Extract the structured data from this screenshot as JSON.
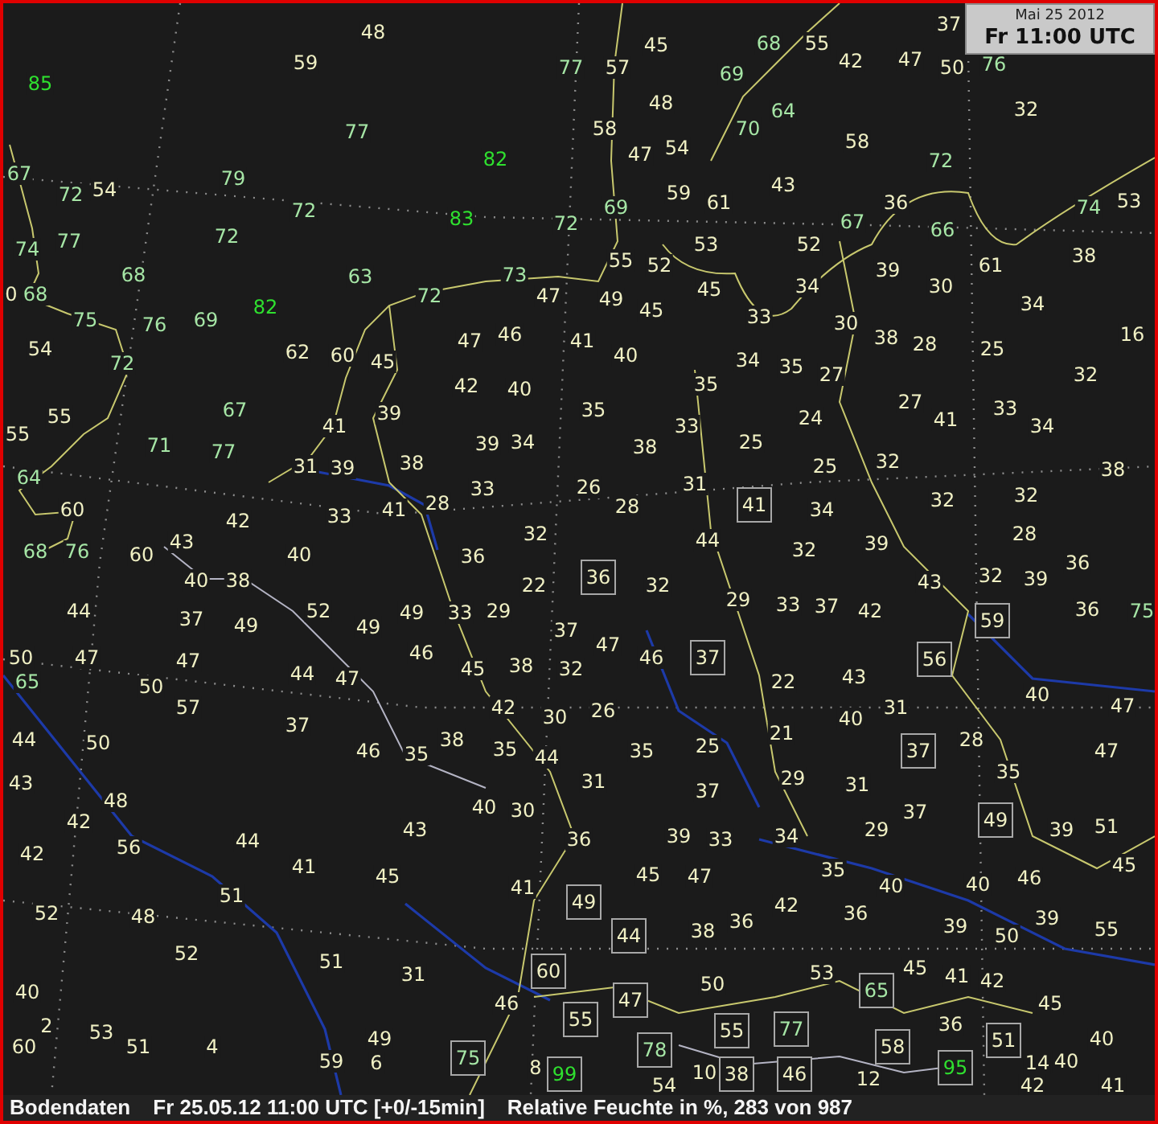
{
  "header": {
    "date": "Mai 25 2012",
    "time": "Fr 11:00 UTC"
  },
  "stations": [
    {
      "value": "48",
      "kind": "land",
      "boxed": false
    },
    {
      "value": "37",
      "kind": "land",
      "boxed": false
    },
    {
      "value": "45",
      "kind": "land",
      "boxed": false
    },
    {
      "value": "68",
      "kind": "sea",
      "boxed": false
    },
    {
      "value": "55",
      "kind": "land",
      "boxed": false
    },
    {
      "value": "59",
      "kind": "land",
      "boxed": false
    },
    {
      "value": "77",
      "kind": "sea",
      "boxed": false
    },
    {
      "value": "57",
      "kind": "land",
      "boxed": false
    },
    {
      "value": "69",
      "kind": "sea",
      "boxed": false
    },
    {
      "value": "42",
      "kind": "land",
      "boxed": false
    },
    {
      "value": "47",
      "kind": "land",
      "boxed": false
    },
    {
      "value": "50",
      "kind": "land",
      "boxed": false
    },
    {
      "value": "76",
      "kind": "sea",
      "boxed": false
    },
    {
      "value": "85",
      "kind": "high",
      "boxed": false
    },
    {
      "value": "48",
      "kind": "land",
      "boxed": false
    },
    {
      "value": "64",
      "kind": "sea",
      "boxed": false
    },
    {
      "value": "32",
      "kind": "land",
      "boxed": false
    },
    {
      "value": "77",
      "kind": "sea",
      "boxed": false
    },
    {
      "value": "58",
      "kind": "land",
      "boxed": false
    },
    {
      "value": "70",
      "kind": "sea",
      "boxed": false
    },
    {
      "value": "54",
      "kind": "land",
      "boxed": false
    },
    {
      "value": "58",
      "kind": "land",
      "boxed": false
    },
    {
      "value": "82",
      "kind": "high",
      "boxed": false
    },
    {
      "value": "47",
      "kind": "land",
      "boxed": false
    },
    {
      "value": "72",
      "kind": "sea",
      "boxed": false
    },
    {
      "value": "67",
      "kind": "sea",
      "boxed": false
    },
    {
      "value": "54",
      "kind": "land",
      "boxed": false
    },
    {
      "value": "79",
      "kind": "sea",
      "boxed": false
    },
    {
      "value": "43",
      "kind": "land",
      "boxed": false
    },
    {
      "value": "72",
      "kind": "sea",
      "boxed": false
    },
    {
      "value": "72",
      "kind": "sea",
      "boxed": false
    },
    {
      "value": "69",
      "kind": "sea",
      "boxed": false
    },
    {
      "value": "59",
      "kind": "land",
      "boxed": false
    },
    {
      "value": "61",
      "kind": "land",
      "boxed": false
    },
    {
      "value": "36",
      "kind": "land",
      "boxed": false
    },
    {
      "value": "74",
      "kind": "sea",
      "boxed": false
    },
    {
      "value": "53",
      "kind": "land",
      "boxed": false
    },
    {
      "value": "83",
      "kind": "high",
      "boxed": false
    },
    {
      "value": "72",
      "kind": "sea",
      "boxed": false
    },
    {
      "value": "67",
      "kind": "sea",
      "boxed": false
    },
    {
      "value": "66",
      "kind": "sea",
      "boxed": false
    },
    {
      "value": "74",
      "kind": "sea",
      "boxed": false
    },
    {
      "value": "77",
      "kind": "sea",
      "boxed": false
    },
    {
      "value": "72",
      "kind": "sea",
      "boxed": false
    },
    {
      "value": "53",
      "kind": "land",
      "boxed": false
    },
    {
      "value": "52",
      "kind": "land",
      "boxed": false
    },
    {
      "value": "55",
      "kind": "land",
      "boxed": false
    },
    {
      "value": "52",
      "kind": "land",
      "boxed": false
    },
    {
      "value": "61",
      "kind": "land",
      "boxed": false
    },
    {
      "value": "38",
      "kind": "land",
      "boxed": false
    },
    {
      "value": "68",
      "kind": "sea",
      "boxed": false
    },
    {
      "value": "63",
      "kind": "sea",
      "boxed": false
    },
    {
      "value": "73",
      "kind": "sea",
      "boxed": false
    },
    {
      "value": "34",
      "kind": "land",
      "boxed": false
    },
    {
      "value": "39",
      "kind": "land",
      "boxed": false
    },
    {
      "value": "30",
      "kind": "land",
      "boxed": false
    },
    {
      "value": "0",
      "kind": "land",
      "boxed": false
    },
    {
      "value": "68",
      "kind": "sea",
      "boxed": false
    },
    {
      "value": "82",
      "kind": "high",
      "boxed": false
    },
    {
      "value": "72",
      "kind": "sea",
      "boxed": false
    },
    {
      "value": "47",
      "kind": "land",
      "boxed": false
    },
    {
      "value": "49",
      "kind": "land",
      "boxed": false
    },
    {
      "value": "45",
      "kind": "land",
      "boxed": false
    },
    {
      "value": "34",
      "kind": "land",
      "boxed": false
    },
    {
      "value": "75",
      "kind": "sea",
      "boxed": false
    },
    {
      "value": "76",
      "kind": "sea",
      "boxed": false
    },
    {
      "value": "69",
      "kind": "sea",
      "boxed": false
    },
    {
      "value": "45",
      "kind": "land",
      "boxed": false
    },
    {
      "value": "33",
      "kind": "land",
      "boxed": false
    },
    {
      "value": "30",
      "kind": "land",
      "boxed": false
    },
    {
      "value": "47",
      "kind": "land",
      "boxed": false
    },
    {
      "value": "46",
      "kind": "land",
      "boxed": false
    },
    {
      "value": "41",
      "kind": "land",
      "boxed": false
    },
    {
      "value": "38",
      "kind": "land",
      "boxed": false
    },
    {
      "value": "28",
      "kind": "land",
      "boxed": false
    },
    {
      "value": "16",
      "kind": "land",
      "boxed": false
    },
    {
      "value": "54",
      "kind": "land",
      "boxed": false
    },
    {
      "value": "72",
      "kind": "sea",
      "boxed": false
    },
    {
      "value": "62",
      "kind": "land",
      "boxed": false
    },
    {
      "value": "60",
      "kind": "land",
      "boxed": false
    },
    {
      "value": "45",
      "kind": "land",
      "boxed": false
    },
    {
      "value": "40",
      "kind": "land",
      "boxed": false
    },
    {
      "value": "34",
      "kind": "land",
      "boxed": false
    },
    {
      "value": "25",
      "kind": "land",
      "boxed": false
    },
    {
      "value": "35",
      "kind": "land",
      "boxed": false
    },
    {
      "value": "35",
      "kind": "land",
      "boxed": false
    },
    {
      "value": "27",
      "kind": "land",
      "boxed": false
    },
    {
      "value": "32",
      "kind": "land",
      "boxed": false
    },
    {
      "value": "42",
      "kind": "land",
      "boxed": false
    },
    {
      "value": "40",
      "kind": "land",
      "boxed": false
    },
    {
      "value": "27",
      "kind": "land",
      "boxed": false
    },
    {
      "value": "55",
      "kind": "land",
      "boxed": false
    },
    {
      "value": "67",
      "kind": "sea",
      "boxed": false
    },
    {
      "value": "39",
      "kind": "land",
      "boxed": false
    },
    {
      "value": "35",
      "kind": "land",
      "boxed": false
    },
    {
      "value": "24",
      "kind": "land",
      "boxed": false
    },
    {
      "value": "41",
      "kind": "land",
      "boxed": false
    },
    {
      "value": "33",
      "kind": "land",
      "boxed": false
    },
    {
      "value": "55",
      "kind": "land",
      "boxed": false
    },
    {
      "value": "41",
      "kind": "land",
      "boxed": false
    },
    {
      "value": "34",
      "kind": "land",
      "boxed": false
    },
    {
      "value": "33",
      "kind": "land",
      "boxed": false
    },
    {
      "value": "25",
      "kind": "land",
      "boxed": false
    },
    {
      "value": "34",
      "kind": "land",
      "boxed": false
    },
    {
      "value": "71",
      "kind": "sea",
      "boxed": false
    },
    {
      "value": "77",
      "kind": "sea",
      "boxed": false
    },
    {
      "value": "39",
      "kind": "land",
      "boxed": false
    },
    {
      "value": "38",
      "kind": "land",
      "boxed": false
    },
    {
      "value": "32",
      "kind": "land",
      "boxed": false
    },
    {
      "value": "64",
      "kind": "sea",
      "boxed": false
    },
    {
      "value": "31",
      "kind": "land",
      "boxed": false
    },
    {
      "value": "39",
      "kind": "land",
      "boxed": false
    },
    {
      "value": "38",
      "kind": "land",
      "boxed": false
    },
    {
      "value": "25",
      "kind": "land",
      "boxed": false
    },
    {
      "value": "38",
      "kind": "land",
      "boxed": false
    },
    {
      "value": "33",
      "kind": "land",
      "boxed": false
    },
    {
      "value": "26",
      "kind": "land",
      "boxed": false
    },
    {
      "value": "31",
      "kind": "land",
      "boxed": false
    },
    {
      "value": "32",
      "kind": "land",
      "boxed": false
    },
    {
      "value": "32",
      "kind": "land",
      "boxed": false
    },
    {
      "value": "60",
      "kind": "land",
      "boxed": false
    },
    {
      "value": "33",
      "kind": "land",
      "boxed": false
    },
    {
      "value": "41",
      "kind": "land",
      "boxed": false
    },
    {
      "value": "28",
      "kind": "land",
      "boxed": false
    },
    {
      "value": "28",
      "kind": "land",
      "boxed": false
    },
    {
      "value": "41",
      "kind": "land",
      "boxed": true
    },
    {
      "value": "34",
      "kind": "land",
      "boxed": false
    },
    {
      "value": "42",
      "kind": "land",
      "boxed": false
    },
    {
      "value": "32",
      "kind": "land",
      "boxed": false
    },
    {
      "value": "28",
      "kind": "land",
      "boxed": false
    },
    {
      "value": "68",
      "kind": "sea",
      "boxed": false
    },
    {
      "value": "76",
      "kind": "sea",
      "boxed": false
    },
    {
      "value": "60",
      "kind": "land",
      "boxed": false
    },
    {
      "value": "43",
      "kind": "land",
      "boxed": false
    },
    {
      "value": "40",
      "kind": "land",
      "boxed": false
    },
    {
      "value": "36",
      "kind": "land",
      "boxed": false
    },
    {
      "value": "44",
      "kind": "land",
      "boxed": false
    },
    {
      "value": "32",
      "kind": "land",
      "boxed": false
    },
    {
      "value": "39",
      "kind": "land",
      "boxed": false
    },
    {
      "value": "36",
      "kind": "land",
      "boxed": true
    },
    {
      "value": "32",
      "kind": "land",
      "boxed": false
    },
    {
      "value": "36",
      "kind": "land",
      "boxed": false
    },
    {
      "value": "40",
      "kind": "land",
      "boxed": false
    },
    {
      "value": "38",
      "kind": "land",
      "boxed": false
    },
    {
      "value": "22",
      "kind": "land",
      "boxed": false
    },
    {
      "value": "32",
      "kind": "land",
      "boxed": false
    },
    {
      "value": "43",
      "kind": "land",
      "boxed": false
    },
    {
      "value": "39",
      "kind": "land",
      "boxed": false
    },
    {
      "value": "44",
      "kind": "land",
      "boxed": false
    },
    {
      "value": "52",
      "kind": "land",
      "boxed": false
    },
    {
      "value": "49",
      "kind": "land",
      "boxed": false
    },
    {
      "value": "33",
      "kind": "land",
      "boxed": false
    },
    {
      "value": "29",
      "kind": "land",
      "boxed": false
    },
    {
      "value": "29",
      "kind": "land",
      "boxed": false
    },
    {
      "value": "33",
      "kind": "land",
      "boxed": false
    },
    {
      "value": "37",
      "kind": "land",
      "boxed": false
    },
    {
      "value": "42",
      "kind": "land",
      "boxed": false
    },
    {
      "value": "36",
      "kind": "land",
      "boxed": false
    },
    {
      "value": "75",
      "kind": "sea",
      "boxed": false
    },
    {
      "value": "37",
      "kind": "land",
      "boxed": false
    },
    {
      "value": "49",
      "kind": "land",
      "boxed": false
    },
    {
      "value": "49",
      "kind": "land",
      "boxed": false
    },
    {
      "value": "37",
      "kind": "land",
      "boxed": false
    },
    {
      "value": "59",
      "kind": "land",
      "boxed": true
    },
    {
      "value": "46",
      "kind": "land",
      "boxed": false
    },
    {
      "value": "47",
      "kind": "land",
      "boxed": false
    },
    {
      "value": "50",
      "kind": "land",
      "boxed": false
    },
    {
      "value": "47",
      "kind": "land",
      "boxed": false
    },
    {
      "value": "47",
      "kind": "land",
      "boxed": false
    },
    {
      "value": "44",
      "kind": "land",
      "boxed": false
    },
    {
      "value": "45",
      "kind": "land",
      "boxed": false
    },
    {
      "value": "38",
      "kind": "land",
      "boxed": false
    },
    {
      "value": "32",
      "kind": "land",
      "boxed": false
    },
    {
      "value": "46",
      "kind": "land",
      "boxed": false
    },
    {
      "value": "37",
      "kind": "land",
      "boxed": true
    },
    {
      "value": "56",
      "kind": "land",
      "boxed": true
    },
    {
      "value": "65",
      "kind": "sea",
      "boxed": false
    },
    {
      "value": "50",
      "kind": "land",
      "boxed": false
    },
    {
      "value": "47",
      "kind": "land",
      "boxed": false
    },
    {
      "value": "22",
      "kind": "land",
      "boxed": false
    },
    {
      "value": "43",
      "kind": "land",
      "boxed": false
    },
    {
      "value": "57",
      "kind": "land",
      "boxed": false
    },
    {
      "value": "42",
      "kind": "land",
      "boxed": false
    },
    {
      "value": "26",
      "kind": "land",
      "boxed": false
    },
    {
      "value": "31",
      "kind": "land",
      "boxed": false
    },
    {
      "value": "40",
      "kind": "land",
      "boxed": false
    },
    {
      "value": "47",
      "kind": "land",
      "boxed": false
    },
    {
      "value": "37",
      "kind": "land",
      "boxed": false
    },
    {
      "value": "30",
      "kind": "land",
      "boxed": false
    },
    {
      "value": "40",
      "kind": "land",
      "boxed": false
    },
    {
      "value": "44",
      "kind": "land",
      "boxed": false
    },
    {
      "value": "50",
      "kind": "land",
      "boxed": false
    },
    {
      "value": "46",
      "kind": "land",
      "boxed": false
    },
    {
      "value": "35",
      "kind": "land",
      "boxed": false
    },
    {
      "value": "38",
      "kind": "land",
      "boxed": false
    },
    {
      "value": "35",
      "kind": "land",
      "boxed": false
    },
    {
      "value": "44",
      "kind": "land",
      "boxed": false
    },
    {
      "value": "35",
      "kind": "land",
      "boxed": false
    },
    {
      "value": "25",
      "kind": "land",
      "boxed": false
    },
    {
      "value": "21",
      "kind": "land",
      "boxed": false
    },
    {
      "value": "37",
      "kind": "land",
      "boxed": true
    },
    {
      "value": "28",
      "kind": "land",
      "boxed": false
    },
    {
      "value": "47",
      "kind": "land",
      "boxed": false
    },
    {
      "value": "43",
      "kind": "land",
      "boxed": false
    },
    {
      "value": "31",
      "kind": "land",
      "boxed": false
    },
    {
      "value": "29",
      "kind": "land",
      "boxed": false
    },
    {
      "value": "31",
      "kind": "land",
      "boxed": false
    },
    {
      "value": "35",
      "kind": "land",
      "boxed": false
    },
    {
      "value": "48",
      "kind": "land",
      "boxed": false
    },
    {
      "value": "40",
      "kind": "land",
      "boxed": false
    },
    {
      "value": "37",
      "kind": "land",
      "boxed": false
    },
    {
      "value": "42",
      "kind": "land",
      "boxed": false
    },
    {
      "value": "30",
      "kind": "land",
      "boxed": false
    },
    {
      "value": "37",
      "kind": "land",
      "boxed": false
    },
    {
      "value": "49",
      "kind": "land",
      "boxed": true
    },
    {
      "value": "51",
      "kind": "land",
      "boxed": false
    },
    {
      "value": "56",
      "kind": "land",
      "boxed": false
    },
    {
      "value": "44",
      "kind": "land",
      "boxed": false
    },
    {
      "value": "43",
      "kind": "land",
      "boxed": false
    },
    {
      "value": "36",
      "kind": "land",
      "boxed": false
    },
    {
      "value": "39",
      "kind": "land",
      "boxed": false
    },
    {
      "value": "33",
      "kind": "land",
      "boxed": false
    },
    {
      "value": "34",
      "kind": "land",
      "boxed": false
    },
    {
      "value": "29",
      "kind": "land",
      "boxed": false
    },
    {
      "value": "39",
      "kind": "land",
      "boxed": false
    },
    {
      "value": "42",
      "kind": "land",
      "boxed": false
    },
    {
      "value": "41",
      "kind": "land",
      "boxed": false
    },
    {
      "value": "45",
      "kind": "land",
      "boxed": false
    },
    {
      "value": "45",
      "kind": "land",
      "boxed": false
    },
    {
      "value": "45",
      "kind": "land",
      "boxed": false
    },
    {
      "value": "47",
      "kind": "land",
      "boxed": false
    },
    {
      "value": "35",
      "kind": "land",
      "boxed": false
    },
    {
      "value": "40",
      "kind": "land",
      "boxed": false
    },
    {
      "value": "40",
      "kind": "land",
      "boxed": false
    },
    {
      "value": "46",
      "kind": "land",
      "boxed": false
    },
    {
      "value": "51",
      "kind": "land",
      "boxed": false
    },
    {
      "value": "41",
      "kind": "land",
      "boxed": false
    },
    {
      "value": "49",
      "kind": "land",
      "boxed": true
    },
    {
      "value": "42",
      "kind": "land",
      "boxed": false
    },
    {
      "value": "52",
      "kind": "land",
      "boxed": false
    },
    {
      "value": "48",
      "kind": "land",
      "boxed": false
    },
    {
      "value": "36",
      "kind": "land",
      "boxed": false
    },
    {
      "value": "36",
      "kind": "land",
      "boxed": false
    },
    {
      "value": "39",
      "kind": "land",
      "boxed": false
    },
    {
      "value": "44",
      "kind": "land",
      "boxed": true
    },
    {
      "value": "38",
      "kind": "land",
      "boxed": false
    },
    {
      "value": "39",
      "kind": "land",
      "boxed": false
    },
    {
      "value": "50",
      "kind": "land",
      "boxed": false
    },
    {
      "value": "55",
      "kind": "land",
      "boxed": false
    },
    {
      "value": "52",
      "kind": "land",
      "boxed": false
    },
    {
      "value": "51",
      "kind": "land",
      "boxed": false
    },
    {
      "value": "31",
      "kind": "land",
      "boxed": false
    },
    {
      "value": "60",
      "kind": "land",
      "boxed": true
    },
    {
      "value": "53",
      "kind": "land",
      "boxed": false
    },
    {
      "value": "45",
      "kind": "land",
      "boxed": false
    },
    {
      "value": "41",
      "kind": "land",
      "boxed": false
    },
    {
      "value": "42",
      "kind": "land",
      "boxed": false
    },
    {
      "value": "40",
      "kind": "land",
      "boxed": false
    },
    {
      "value": "47",
      "kind": "land",
      "boxed": true
    },
    {
      "value": "50",
      "kind": "land",
      "boxed": false
    },
    {
      "value": "65",
      "kind": "sea",
      "boxed": true
    },
    {
      "value": "46",
      "kind": "land",
      "boxed": false
    },
    {
      "value": "55",
      "kind": "land",
      "boxed": true
    },
    {
      "value": "45",
      "kind": "land",
      "boxed": false
    },
    {
      "value": "2",
      "kind": "land",
      "boxed": false
    },
    {
      "value": "53",
      "kind": "land",
      "boxed": false
    },
    {
      "value": "49",
      "kind": "land",
      "boxed": false
    },
    {
      "value": "55",
      "kind": "land",
      "boxed": true
    },
    {
      "value": "77",
      "kind": "sea",
      "boxed": true
    },
    {
      "value": "36",
      "kind": "land",
      "boxed": false
    },
    {
      "value": "51",
      "kind": "land",
      "boxed": true
    },
    {
      "value": "40",
      "kind": "land",
      "boxed": false
    },
    {
      "value": "60",
      "kind": "land",
      "boxed": false
    },
    {
      "value": "51",
      "kind": "land",
      "boxed": false
    },
    {
      "value": "4",
      "kind": "land",
      "boxed": false
    },
    {
      "value": "75",
      "kind": "sea",
      "boxed": true
    },
    {
      "value": "78",
      "kind": "sea",
      "boxed": true
    },
    {
      "value": "58",
      "kind": "land",
      "boxed": true
    },
    {
      "value": "59",
      "kind": "land",
      "boxed": false
    },
    {
      "value": "6",
      "kind": "land",
      "boxed": false
    },
    {
      "value": "8",
      "kind": "land",
      "boxed": false
    },
    {
      "value": "99",
      "kind": "high",
      "boxed": true
    },
    {
      "value": "10",
      "kind": "land",
      "boxed": false
    },
    {
      "value": "38",
      "kind": "land",
      "boxed": true
    },
    {
      "value": "46",
      "kind": "land",
      "boxed": true
    },
    {
      "value": "12",
      "kind": "land",
      "boxed": false
    },
    {
      "value": "95",
      "kind": "high",
      "boxed": true
    },
    {
      "value": "14",
      "kind": "land",
      "boxed": false
    },
    {
      "value": "40",
      "kind": "land",
      "boxed": false
    },
    {
      "value": "54",
      "kind": "land",
      "boxed": false
    },
    {
      "value": "42",
      "kind": "land",
      "boxed": false
    },
    {
      "value": "41",
      "kind": "land",
      "boxed": false
    }
  ],
  "status_bar": {
    "source": "Bodendaten",
    "time": "Fr 25.05.12 11:00 UTC [+0/-15min]",
    "parameter": "Relative Feuchte in %, 283 von 987"
  }
}
